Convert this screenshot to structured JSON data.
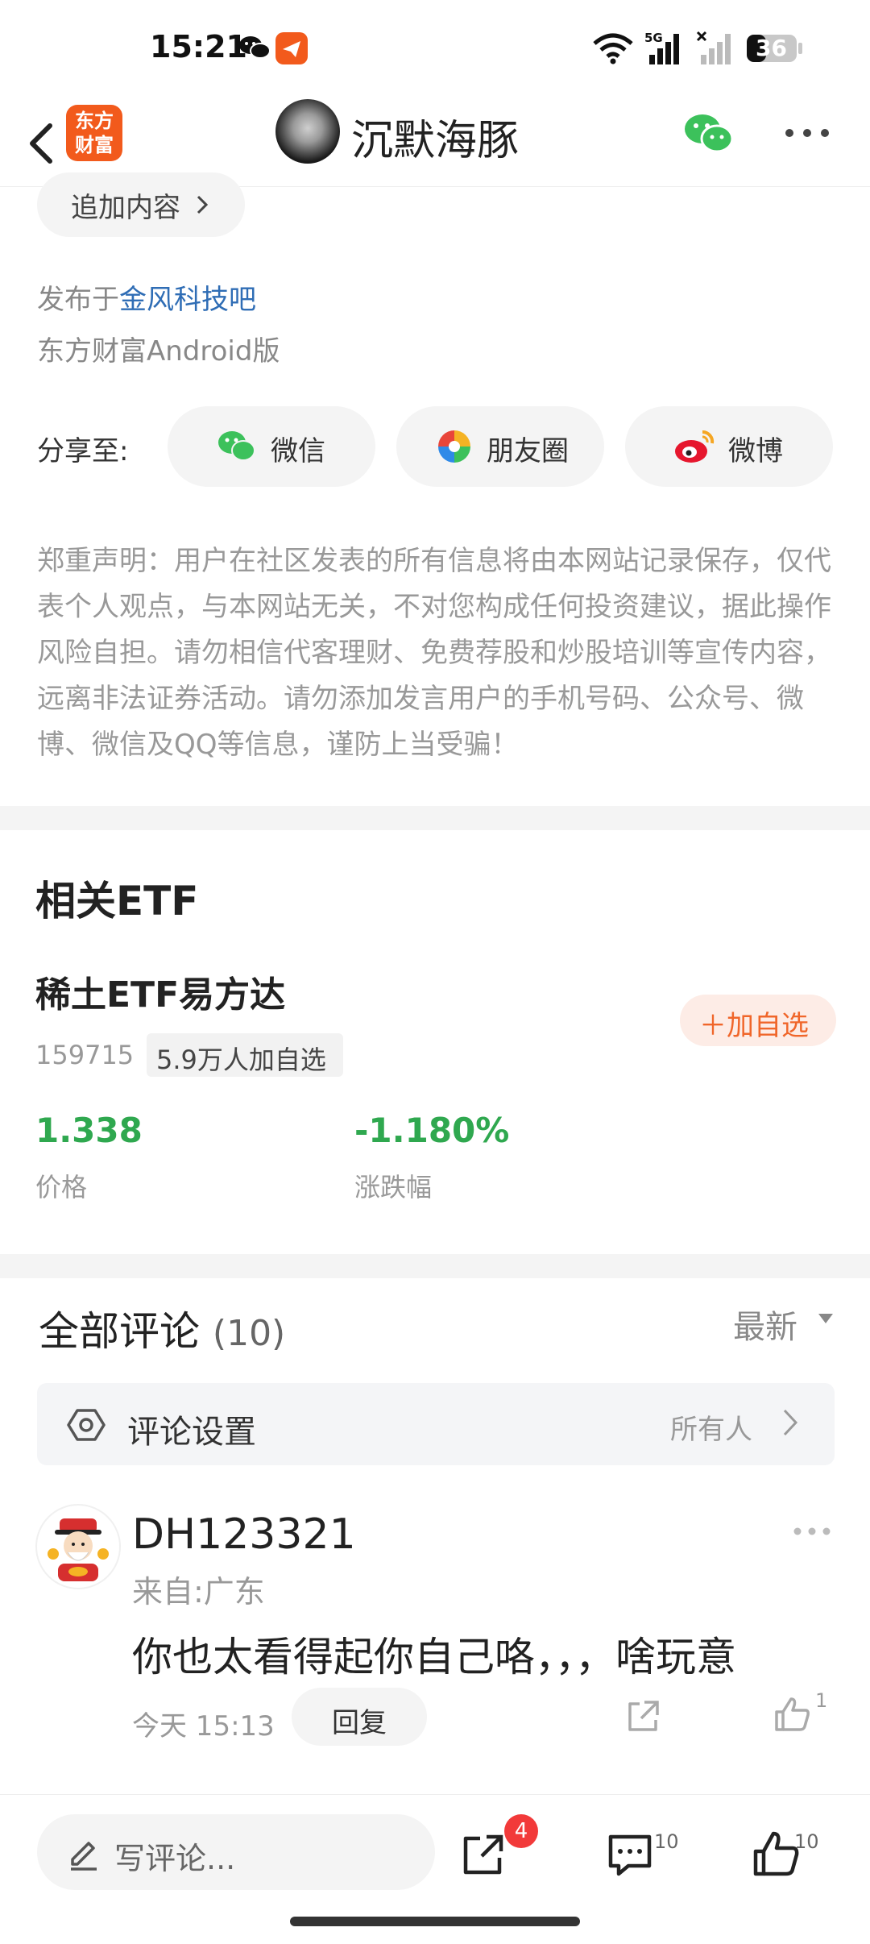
{
  "status_bar": {
    "time": "15:21",
    "network_label": "5G",
    "battery": "36"
  },
  "nav": {
    "logo_line1": "东方",
    "logo_line2": "财富",
    "title": "沉默海豚"
  },
  "post": {
    "append_label": "追加内容",
    "publish_prefix": "发布于",
    "publish_forum": "金风科技吧",
    "version": "东方财富Android版"
  },
  "share": {
    "label": "分享至:",
    "wechat": "微信",
    "moments": "朋友圈",
    "weibo": "微博"
  },
  "disclaimer": "郑重声明：用户在社区发表的所有信息将由本网站记录保存，仅代表个人观点，与本网站无关，不对您构成任何投资建议，据此操作风险自担。请勿相信代客理财、免费荐股和炒股培训等宣传内容，远离非法证券活动。请勿添加发言用户的手机号码、公众号、微博、微信及QQ等信息，谨防上当受骗！",
  "etf": {
    "section_title": "相关ETF",
    "name": "稀土ETF易方达",
    "code": "159715",
    "followers": "5.9万人加自选",
    "add_button": "＋加自选",
    "price_value": "1.338",
    "price_label": "价格",
    "change_value": "-1.180%",
    "change_label": "涨跌幅"
  },
  "comments": {
    "title": "全部评论",
    "count": "(10)",
    "sort": "最新",
    "settings_label": "评论设置",
    "settings_value": "所有人",
    "items": [
      {
        "user": "DH123321",
        "location": "来自:广东",
        "text": "你也太看得起你自己咯，，，啥玩意",
        "time": "今天 15:13",
        "reply_label": "回复",
        "likes": "1"
      }
    ]
  },
  "bottom_bar": {
    "write_placeholder": "写评论...",
    "share_badge": "4",
    "comment_count": "10",
    "like_count": "10"
  },
  "colors": {
    "accent_orange": "#f0662a",
    "logo_orange": "#f25a1c",
    "link_blue": "#2f6db5",
    "green": "#2fa84f",
    "badge_red": "#f23a3a"
  }
}
